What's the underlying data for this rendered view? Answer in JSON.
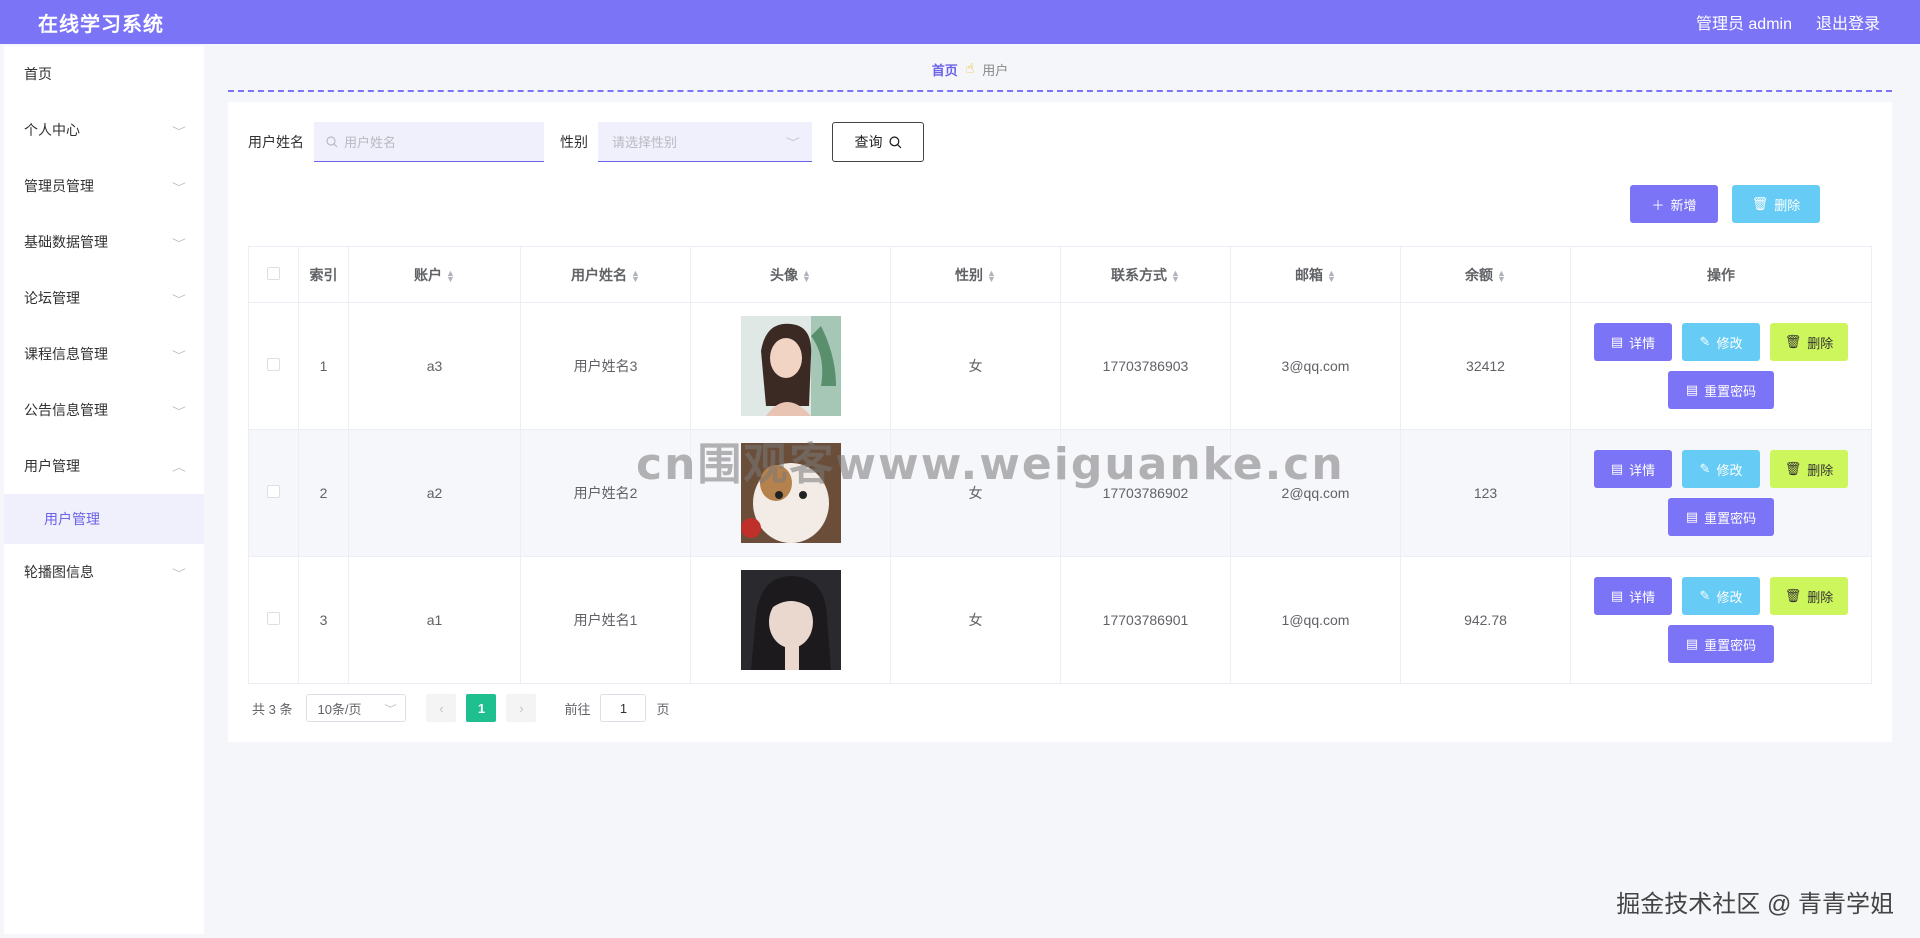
{
  "header": {
    "title": "在线学习系统",
    "user_label": "管理员 admin",
    "logout_label": "退出登录"
  },
  "sidebar": {
    "items": [
      {
        "label": "首页",
        "chevron": false
      },
      {
        "label": "个人中心",
        "chevron": true
      },
      {
        "label": "管理员管理",
        "chevron": true
      },
      {
        "label": "基础数据管理",
        "chevron": true
      },
      {
        "label": "论坛管理",
        "chevron": true
      },
      {
        "label": "课程信息管理",
        "chevron": true
      },
      {
        "label": "公告信息管理",
        "chevron": true
      },
      {
        "label": "用户管理",
        "chevron": true,
        "expanded": true
      },
      {
        "label": "用户管理",
        "sub": true,
        "active": true
      },
      {
        "label": "轮播图信息",
        "chevron": true
      }
    ]
  },
  "breadcrumb": {
    "home": "首页",
    "current": "用户"
  },
  "search": {
    "name_label": "用户姓名",
    "name_placeholder": "用户姓名",
    "gender_label": "性别",
    "gender_placeholder": "请选择性别",
    "query_label": "查询"
  },
  "actions": {
    "add_label": "新增",
    "delete_label": "删除"
  },
  "table": {
    "columns": [
      "索引",
      "账户",
      "用户姓名",
      "头像",
      "性别",
      "联系方式",
      "邮箱",
      "余额",
      "操作"
    ],
    "rows": [
      {
        "index": "1",
        "account": "a3",
        "name": "用户姓名3",
        "gender": "女",
        "phone": "17703786903",
        "email": "3@qq.com",
        "balance": "32412"
      },
      {
        "index": "2",
        "account": "a2",
        "name": "用户姓名2",
        "gender": "女",
        "phone": "17703786902",
        "email": "2@qq.com",
        "balance": "123"
      },
      {
        "index": "3",
        "account": "a1",
        "name": "用户姓名1",
        "gender": "女",
        "phone": "17703786901",
        "email": "1@qq.com",
        "balance": "942.78"
      }
    ],
    "op_labels": {
      "detail": "详情",
      "edit": "修改",
      "delete": "删除",
      "reset": "重置密码"
    }
  },
  "pagination": {
    "total": "共 3 条",
    "page_size": "10条/页",
    "current_page": "1",
    "goto_prefix": "前往",
    "goto_value": "1",
    "goto_suffix": "页"
  },
  "overlay": {
    "watermark": "cn围观客www.weiguanke.cn",
    "credit": "掘金技术社区 @ 青青学姐"
  },
  "colors": {
    "primary": "#7b74f6",
    "info": "#66ccf5",
    "warn": "#cdf65c",
    "page_active": "#1fbf8f"
  }
}
